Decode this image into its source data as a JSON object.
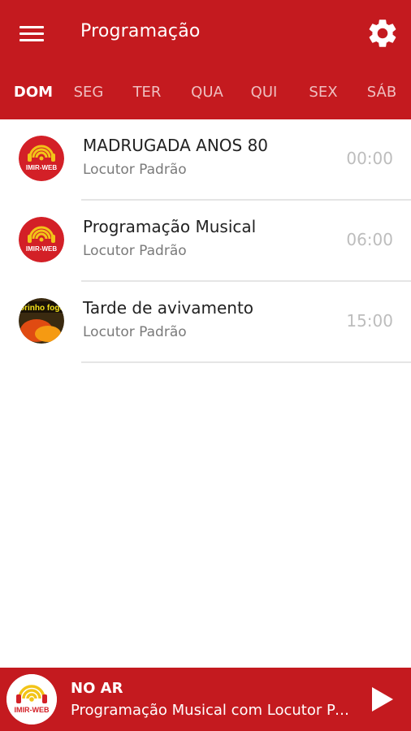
{
  "header": {
    "title": "Programação",
    "menu_icon": "menu-icon",
    "settings_icon": "gear-icon",
    "background_color": "#c41a1f"
  },
  "tabs": [
    {
      "label": "DOM",
      "active": true
    },
    {
      "label": "SEG",
      "active": false
    },
    {
      "label": "TER",
      "active": false
    },
    {
      "label": "QUA",
      "active": false
    },
    {
      "label": "QUI",
      "active": false
    },
    {
      "label": "SEX",
      "active": false
    },
    {
      "label": "SÁB",
      "active": false
    }
  ],
  "schedule": [
    {
      "title": "MADRUGADA ANOS 80",
      "host": "Locutor Padrão",
      "time": "00:00",
      "avatar_text": "IMIR-WEB"
    },
    {
      "title": "Programação Musical",
      "host": "Locutor Padrão",
      "time": "06:00",
      "avatar_text": "IMIR-WEB"
    },
    {
      "title": "Tarde de avivamento",
      "host": "Locutor Padrão",
      "time": "15:00",
      "avatar_text": "corinho fogo"
    }
  ],
  "player": {
    "label": "NO AR",
    "now_playing": "Programação Musical com Locutor Padrão",
    "avatar_text": "IMIR-WEB",
    "play_icon": "play-icon"
  }
}
